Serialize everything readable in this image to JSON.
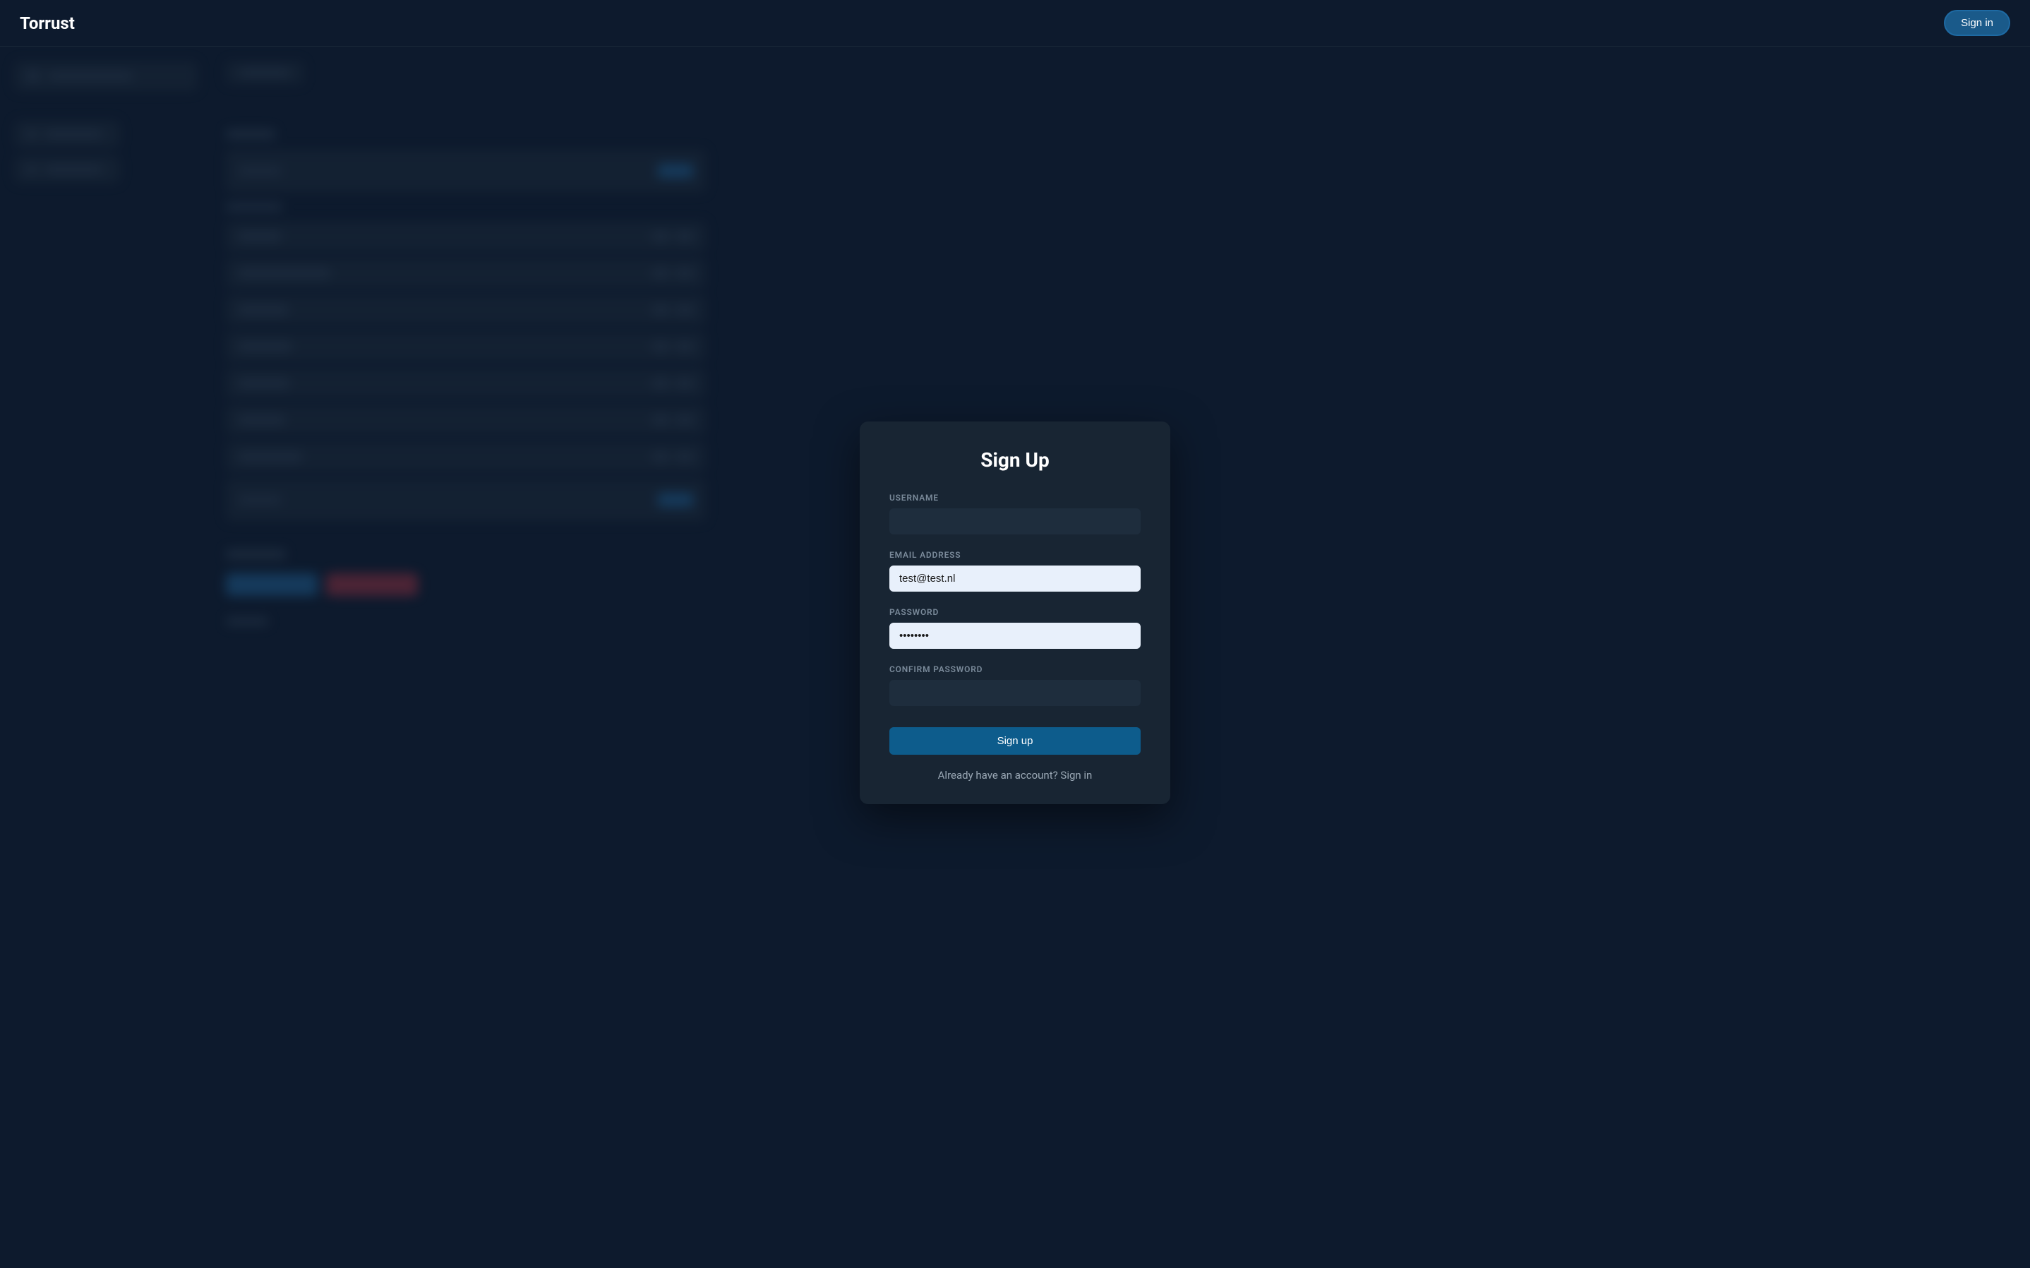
{
  "header": {
    "brand": "Torrust",
    "signin_label": "Sign in"
  },
  "modal": {
    "title": "Sign Up",
    "username_label": "USERNAME",
    "username_value": "",
    "email_label": "EMAIL ADDRESS",
    "email_value": "test@test.nl",
    "password_label": "PASSWORD",
    "password_value": "••••••••",
    "confirm_label": "CONFIRM PASSWORD",
    "confirm_value": "",
    "submit_label": "Sign up",
    "footer_text": "Already have an account? ",
    "footer_link": "Sign in"
  }
}
